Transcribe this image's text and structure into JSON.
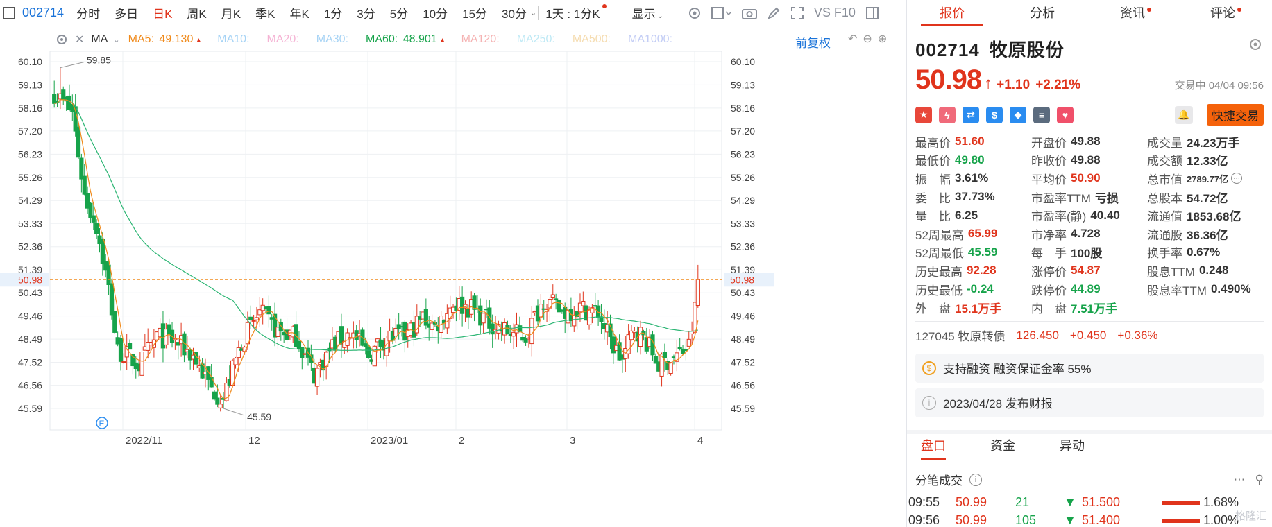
{
  "toolbar": {
    "code": "002714",
    "periods": [
      "分时",
      "多日",
      "日K",
      "周K",
      "月K",
      "季K",
      "年K",
      "1分",
      "3分",
      "5分",
      "10分",
      "15分",
      "30分"
    ],
    "active_period": "日K",
    "kline_mode": "1天 : 1分K",
    "display_label": "显示",
    "extra_label": "VS F10"
  },
  "ma_bar": {
    "type_label": "MA",
    "items": [
      {
        "label": "MA5:",
        "value": "49.130",
        "color": "#f08a1b",
        "arrow": "▲"
      },
      {
        "label": "MA10:",
        "value": "",
        "color": "#a6d3f5",
        "arrow": ""
      },
      {
        "label": "MA20:",
        "value": "",
        "color": "#f5b3d4",
        "arrow": ""
      },
      {
        "label": "MA30:",
        "value": "",
        "color": "#a6d3f5",
        "arrow": ""
      },
      {
        "label": "MA60:",
        "value": "48.901",
        "color": "#16a34a",
        "arrow": "▲"
      },
      {
        "label": "MA120:",
        "value": "",
        "color": "#f5b3b3",
        "arrow": ""
      },
      {
        "label": "MA250:",
        "value": "",
        "color": "#bfe9f5",
        "arrow": ""
      },
      {
        "label": "MA500:",
        "value": "",
        "color": "#f5dcb0",
        "arrow": ""
      },
      {
        "label": "MA1000:",
        "value": "",
        "color": "#c3cdf5",
        "arrow": ""
      }
    ],
    "adjust_label": "前复权"
  },
  "chart_data": {
    "type": "candlestick",
    "y_ticks": [
      "60.10",
      "59.13",
      "58.16",
      "57.20",
      "56.23",
      "55.26",
      "54.29",
      "53.33",
      "52.36",
      "51.39",
      "50.43",
      "49.46",
      "48.49",
      "47.52",
      "46.56",
      "45.59"
    ],
    "x_ticks": [
      "2022/11",
      "12",
      "2023/01",
      "2",
      "3",
      "4"
    ],
    "current_price": "50.98",
    "max_label": "59.85",
    "min_label": "45.59",
    "colors": {
      "up": "#e0341c",
      "down": "#16a34a",
      "ma5": "#f08a1b",
      "ma60": "#2bb573",
      "current": "#f08a1b"
    }
  },
  "quote": {
    "code": "002714",
    "name": "牧原股份",
    "price": "50.98",
    "change": "+1.10",
    "change_pct": "+2.21%",
    "status": "交易中 04/04 09:56",
    "quick_trade": "快捷交易",
    "badges": [
      {
        "icon": "flag-icon",
        "color": "#e8473a",
        "glyph": "★"
      },
      {
        "icon": "lightning-icon",
        "color": "#f06a7a",
        "glyph": "ϟ"
      },
      {
        "icon": "shuffle-icon",
        "color": "#2a8cf0",
        "glyph": "⇄"
      },
      {
        "icon": "dollar-icon",
        "color": "#2a8cf0",
        "glyph": "$"
      },
      {
        "icon": "tag-icon",
        "color": "#2a8cf0",
        "glyph": "◆"
      },
      {
        "icon": "report-icon",
        "color": "#5b6b7e",
        "glyph": "≡"
      },
      {
        "icon": "heart-icon",
        "color": "#f0506a",
        "glyph": "♥"
      }
    ],
    "stats": [
      {
        "k": "最高价",
        "v": "51.60",
        "c": "red"
      },
      {
        "k": "开盘价",
        "v": "49.88",
        "c": ""
      },
      {
        "k": "成交量",
        "v": "24.23万手",
        "c": ""
      },
      {
        "k": "最低价",
        "v": "49.80",
        "c": "green"
      },
      {
        "k": "昨收价",
        "v": "49.88",
        "c": ""
      },
      {
        "k": "成交额",
        "v": "12.33亿",
        "c": ""
      },
      {
        "k": "振　幅",
        "v": "3.61%",
        "c": ""
      },
      {
        "k": "平均价",
        "v": "50.90",
        "c": "red"
      },
      {
        "k": "总市值",
        "v": "2789.77亿",
        "c": "sm"
      },
      {
        "k": "委　比",
        "v": "37.73%",
        "c": ""
      },
      {
        "k": "市盈率TTM",
        "v": "亏损",
        "c": ""
      },
      {
        "k": "总股本",
        "v": "54.72亿",
        "c": ""
      },
      {
        "k": "量　比",
        "v": "6.25",
        "c": ""
      },
      {
        "k": "市盈率(静)",
        "v": "40.40",
        "c": ""
      },
      {
        "k": "流通值",
        "v": "1853.68亿",
        "c": ""
      },
      {
        "k": "52周最高",
        "v": "65.99",
        "c": "red"
      },
      {
        "k": "市净率",
        "v": "4.728",
        "c": ""
      },
      {
        "k": "流通股",
        "v": "36.36亿",
        "c": ""
      },
      {
        "k": "52周最低",
        "v": "45.59",
        "c": "green"
      },
      {
        "k": "每　手",
        "v": "100股",
        "c": ""
      },
      {
        "k": "换手率",
        "v": "0.67%",
        "c": ""
      },
      {
        "k": "历史最高",
        "v": "92.28",
        "c": "red"
      },
      {
        "k": "涨停价",
        "v": "54.87",
        "c": "red"
      },
      {
        "k": "股息TTM",
        "v": "0.248",
        "c": ""
      },
      {
        "k": "历史最低",
        "v": "-0.24",
        "c": "green"
      },
      {
        "k": "跌停价",
        "v": "44.89",
        "c": "green"
      },
      {
        "k": "股息率TTM",
        "v": "0.490%",
        "c": ""
      },
      {
        "k": "外　盘",
        "v": "15.1万手",
        "c": "red"
      },
      {
        "k": "内　盘",
        "v": "7.51万手",
        "c": "green"
      },
      {
        "k": "",
        "v": "",
        "c": ""
      }
    ],
    "convertible": {
      "name": "127045 牧原转债",
      "price": "126.450",
      "chg": "+0.450",
      "pct": "+0.36%"
    },
    "margin_note": "支持融资 融资保证金率 55%",
    "report_note": "2023/04/28  发布财报"
  },
  "panel_tabs": [
    "报价",
    "分析",
    "资讯",
    "评论"
  ],
  "lower_tabs": [
    "盘口",
    "资金",
    "异动"
  ],
  "ticks": {
    "title": "分笔成交",
    "rows": [
      {
        "time": "09:55",
        "price": "50.99",
        "vol": "21",
        "dir": "▼",
        "ask": "51.500",
        "pct": "1.68%"
      },
      {
        "time": "09:56",
        "price": "50.99",
        "vol": "105",
        "dir": "▼",
        "ask": "51.400",
        "pct": "1.00%"
      }
    ]
  },
  "watermark": "格隆汇"
}
